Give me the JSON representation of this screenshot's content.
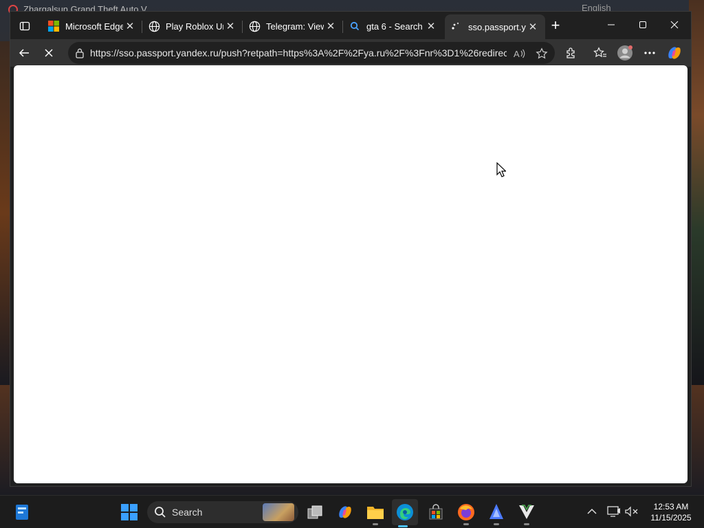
{
  "background": {
    "window_title": "Zhargalsun Grand Theft Auto V",
    "top_right_text": "English"
  },
  "browser": {
    "tabs": [
      {
        "label": "Microsoft Edge",
        "icon": "microsoft-logo-icon"
      },
      {
        "label": "Play Roblox Unb",
        "icon": "globe-icon"
      },
      {
        "label": "Telegram: View",
        "icon": "globe-icon"
      },
      {
        "label": "gta 6 - Search",
        "icon": "search-icon"
      },
      {
        "label": "sso.passport.ya",
        "icon": "loading-spinner-icon",
        "active": true
      }
    ],
    "address": {
      "url": "https://sso.passport.yandex.ru/push?retpath=https%3A%2F%2Fya.ru%2F%3Fnr%3D1%26redirect..."
    },
    "page_loading": true
  },
  "taskbar": {
    "search_label": "Search",
    "apps": [
      "widgets-icon",
      "start-icon",
      "task-view-icon",
      "copilot-icon",
      "file-explorer-icon",
      "edge-icon",
      "store-icon",
      "firefox-icon",
      "app-icon",
      "gta-icon"
    ],
    "active_app": "edge-icon",
    "clock": {
      "time": "12:53 AM",
      "date": "11/15/2025"
    }
  },
  "colors": {
    "accent": "#4cc2ff",
    "tab_active": "#333333",
    "chrome_dark": "#202020"
  }
}
